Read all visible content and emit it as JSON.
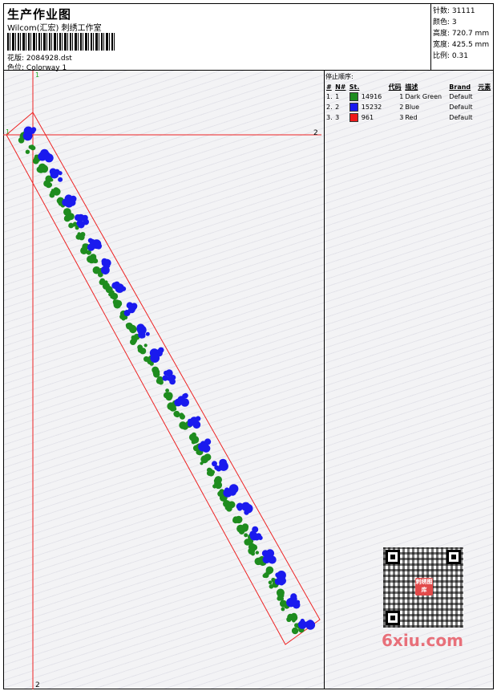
{
  "header": {
    "title": "生产作业图",
    "company": "Wilcom(汇宏) 刺绣工作室",
    "design_label": "花版:",
    "design_value": "2084928.dst",
    "colorway_label": "色位:",
    "colorway_value": "Colorway 1"
  },
  "stats": [
    {
      "label": "针数:",
      "value": "31111"
    },
    {
      "label": "颜色:",
      "value": "3"
    },
    {
      "label": "高度:",
      "value": "720.7 mm"
    },
    {
      "label": "宽度:",
      "value": "425.5 mm"
    },
    {
      "label": "比例:",
      "value": "0.31"
    }
  ],
  "stop_sequence": {
    "title": "停止顺序:",
    "columns": [
      "#",
      "N#",
      "St.",
      "代码",
      "描述",
      "Brand",
      "元素"
    ],
    "rows": [
      {
        "idx": "1.",
        "n": "1",
        "color": "#1e8c1e",
        "stitches": "14916",
        "code": "1",
        "desc": "Dark Green",
        "brand": "Default",
        "element": ""
      },
      {
        "idx": "2.",
        "n": "2",
        "color": "#1a1aee",
        "stitches": "15232",
        "code": "2",
        "desc": "Blue",
        "brand": "Default",
        "element": ""
      },
      {
        "idx": "3.",
        "n": "3",
        "color": "#ee1a1a",
        "stitches": "961",
        "code": "3",
        "desc": "Red",
        "brand": "Default",
        "element": ""
      }
    ]
  },
  "canvas": {
    "marker_top": "1",
    "marker_bottom": "2",
    "marker_left": "1",
    "marker_right": "2",
    "guide_color": "#ee2222",
    "marker_color": "#22aa22",
    "pattern_green": "#1e8c1e",
    "pattern_blue": "#1a1aee"
  },
  "watermark": {
    "brand_text": "6xiu.com",
    "seal_text": "刺绣图库"
  }
}
